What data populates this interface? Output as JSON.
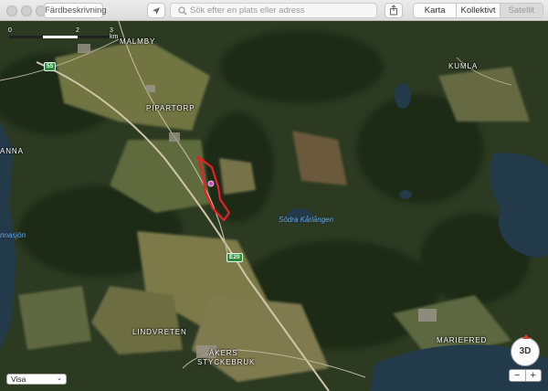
{
  "toolbar": {
    "directions_label": "Färdbeskrivning",
    "location_icon": "location-arrow-icon",
    "search_placeholder": "Sök efter en plats eller adress",
    "share_icon": "share-icon",
    "map_modes": [
      "Karta",
      "Kollektivt",
      "Satellit"
    ],
    "selected_mode": "Satellit"
  },
  "map": {
    "scale": {
      "zero": "0",
      "mid": "2",
      "end": "3 km"
    },
    "places": [
      "MALMBY",
      "KUMLA",
      "PIPARTORP",
      "ANNA",
      "LINDVRETEN",
      "ÅKERS",
      "STYCKEBRUK",
      "MARIEFRED"
    ],
    "water": [
      "Södra Kårlången",
      "nnasjön"
    ],
    "roads": [
      "55",
      "E20"
    ]
  },
  "controls": {
    "view_select": "Visa",
    "three_d": "3D",
    "zoom_out": "−",
    "zoom_in": "+"
  },
  "colors": {
    "route": "#e8202a",
    "marker": "#d04ad0",
    "water": "#233a4a",
    "forest": "#2c3a22"
  }
}
